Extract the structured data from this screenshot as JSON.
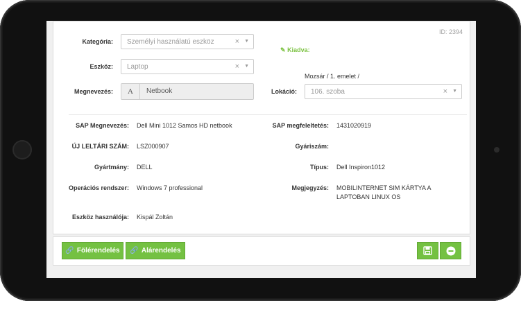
{
  "record": {
    "id_label": "ID: 2394"
  },
  "form": {
    "category": {
      "label": "Kategória:",
      "value": "Személyi használatú eszköz"
    },
    "device": {
      "label": "Eszköz:",
      "value": "Laptop"
    },
    "name": {
      "label": "Megnevezés:",
      "addon": "A",
      "value": "Netbook"
    },
    "status": {
      "label": "Kiadva:"
    },
    "location": {
      "label": "Lokáció:",
      "path": "Mozsár / 1. emelet /",
      "value": "106. szoba"
    }
  },
  "details": {
    "sap_name": {
      "label": "SAP Megnevezés:",
      "value": "Dell Mini 1012 Samos HD netbook"
    },
    "sap_match": {
      "label": "SAP megfeleltetés:",
      "value": "1431020919"
    },
    "inventory_no": {
      "label": "ÚJ LELTÁRI SZÁM:",
      "value": "LSZ000907"
    },
    "serial_no": {
      "label": "Gyáriszám:",
      "value": ""
    },
    "manufacturer": {
      "label": "Gyártmány:",
      "value": "DELL"
    },
    "type": {
      "label": "Típus:",
      "value": "Dell Inspiron1012"
    },
    "os": {
      "label": "Operációs rendszer:",
      "value": "Windows 7 professional"
    },
    "note": {
      "label": "Megjegyzés:",
      "line1": "MOBILINTERNET SIM KÁRTYA A",
      "line2": "LAPTOBAN LINUX OS"
    },
    "user": {
      "label": "Eszköz használója:",
      "value": "Kispál Zoltán"
    }
  },
  "footer": {
    "parent_button": "Fölérendelés",
    "child_button": "Alárendelés"
  },
  "colors": {
    "accent": "#74c142",
    "status_green": "#7cc242"
  }
}
